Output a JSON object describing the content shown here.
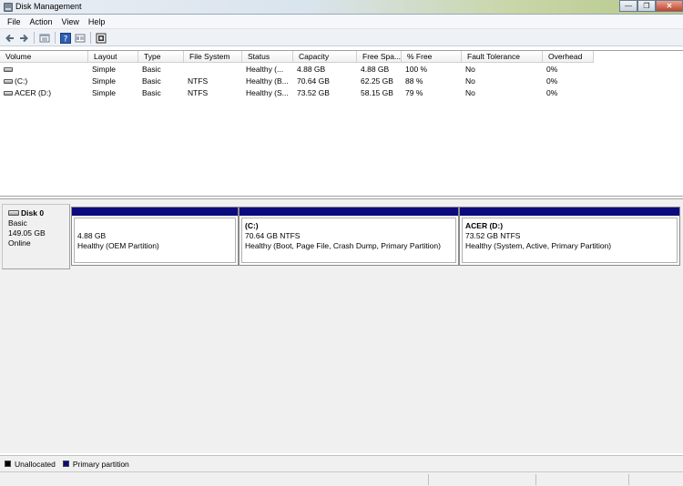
{
  "window": {
    "title": "Disk Management"
  },
  "menu": [
    "File",
    "Action",
    "View",
    "Help"
  ],
  "toolbar": {
    "buttons": [
      "back-icon",
      "forward-icon",
      "disk-list-icon",
      "help-icon",
      "properties-icon",
      "rescan-icon"
    ]
  },
  "columns": [
    "Volume",
    "Layout",
    "Type",
    "File System",
    "Status",
    "Capacity",
    "Free Spa...",
    "% Free",
    "Fault Tolerance",
    "Overhead"
  ],
  "volumes": [
    {
      "volume": "",
      "layout": "Simple",
      "type": "Basic",
      "fs": "",
      "status": "Healthy (...",
      "capacity": "4.88 GB",
      "free": "4.88 GB",
      "pct": "100 %",
      "fault": "No",
      "overhead": "0%"
    },
    {
      "volume": "(C:)",
      "layout": "Simple",
      "type": "Basic",
      "fs": "NTFS",
      "status": "Healthy (B...",
      "capacity": "70.64 GB",
      "free": "62.25 GB",
      "pct": "88 %",
      "fault": "No",
      "overhead": "0%"
    },
    {
      "volume": "ACER (D:)",
      "layout": "Simple",
      "type": "Basic",
      "fs": "NTFS",
      "status": "Healthy (S...",
      "capacity": "73.52 GB",
      "free": "58.15 GB",
      "pct": "79 %",
      "fault": "No",
      "overhead": "0%"
    }
  ],
  "disk": {
    "name": "Disk 0",
    "type": "Basic",
    "size": "149.05 GB",
    "state": "Online"
  },
  "partitions": [
    {
      "name": "",
      "size": "4.88 GB",
      "status": "Healthy (OEM Partition)"
    },
    {
      "name": "(C:)",
      "size": "70.64 GB NTFS",
      "status": "Healthy (Boot, Page File, Crash Dump, Primary Partition)"
    },
    {
      "name": "ACER  (D:)",
      "size": "73.52 GB NTFS",
      "status": "Healthy (System, Active, Primary Partition)"
    }
  ],
  "legend": [
    {
      "label": "Unallocated",
      "color": "#000000"
    },
    {
      "label": "Primary partition",
      "color": "#0b0b7d"
    }
  ],
  "colors": {
    "partition_bar": "#0b0b7d",
    "accent": "#0b0b7d"
  }
}
